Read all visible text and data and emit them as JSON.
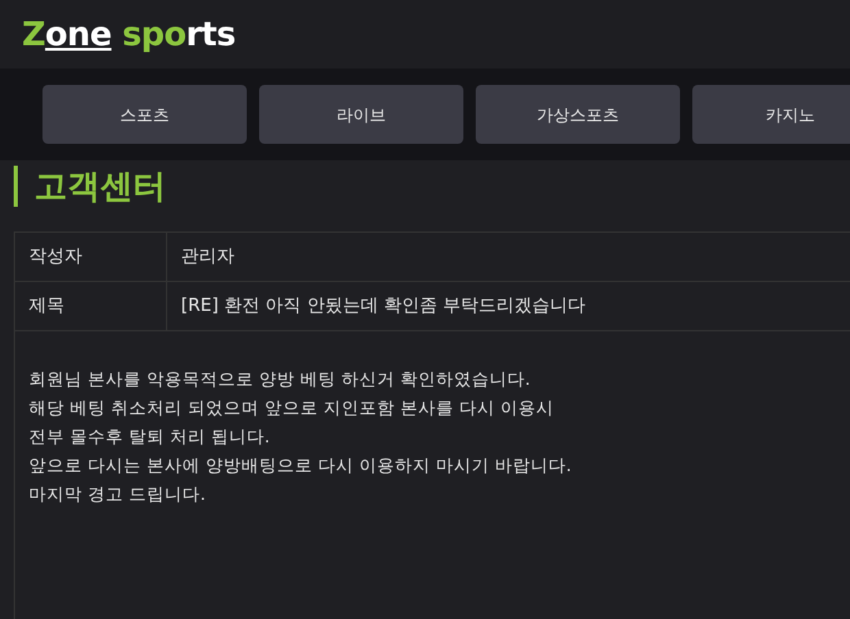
{
  "logo": {
    "parts": [
      {
        "text": "Z",
        "color": "#8cc63f",
        "underline": false
      },
      {
        "text": "one",
        "color": "#ffffff",
        "underline": true
      },
      {
        "text": " spo",
        "color": "#8cc63f",
        "underline": false
      },
      {
        "text": "rts",
        "color": "#ffffff",
        "underline": false
      }
    ]
  },
  "nav": [
    {
      "label": "스포츠"
    },
    {
      "label": "라이브"
    },
    {
      "label": "가상스포츠"
    },
    {
      "label": "카지노"
    }
  ],
  "page_title": "고객센터",
  "details": [
    {
      "label": "작성자",
      "value": "관리자"
    },
    {
      "label": "제목",
      "value": "[RE] 환전 아직 안됬는데 확인좀 부탁드리겠습니다"
    }
  ],
  "message": [
    "회원님 본사를 악용목적으로 양방 베팅 하신거 확인하였습니다.",
    "해당 베팅 취소처리 되었으며 앞으로 지인포함 본사를 다시 이용시",
    "전부 몰수후 탈퇴 처리 됩니다.",
    "앞으로 다시는 본사에 양방배팅으로 다시 이용하지 마시기 바랍니다.",
    "마지막 경고 드립니다."
  ]
}
